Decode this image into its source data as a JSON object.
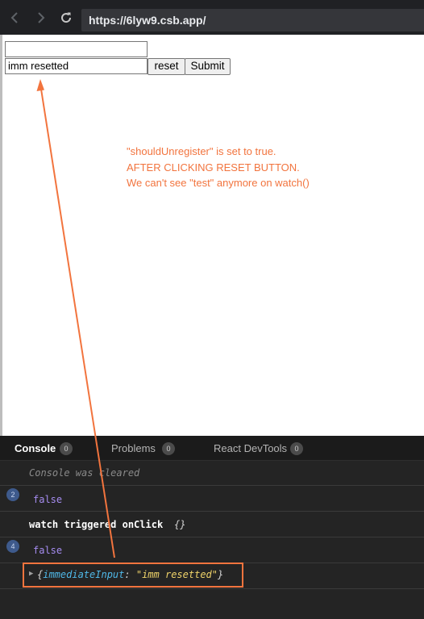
{
  "browser": {
    "url": "https://6lyw9.csb.app/",
    "icons": [
      "back-arrow-icon",
      "forward-arrow-icon",
      "reload-icon"
    ]
  },
  "page": {
    "input1_value": "",
    "input2_value": "imm resetted",
    "reset_label": "reset",
    "submit_label": "Submit",
    "note_lines": [
      "\"shouldUnregister\" is set to true.",
      "AFTER CLICKING RESET BUTTON.",
      "We can't see \"test\" anymore on watch()"
    ],
    "annotation_color": "#f2743e"
  },
  "devtools": {
    "tabs": [
      {
        "label": "Console",
        "count": "0"
      },
      {
        "label": "Problems",
        "count": "0"
      },
      {
        "label": "React DevTools",
        "count": "0"
      }
    ],
    "console": {
      "cleared_message": "Console was cleared",
      "rows": [
        {
          "count": "2",
          "text": "false"
        },
        {
          "label": "watch triggered onClick",
          "value": "{}"
        },
        {
          "count": "4",
          "text": "false"
        },
        {
          "object": {
            "key": "immediateInput",
            "value": "\"imm resetted\""
          }
        }
      ]
    }
  }
}
